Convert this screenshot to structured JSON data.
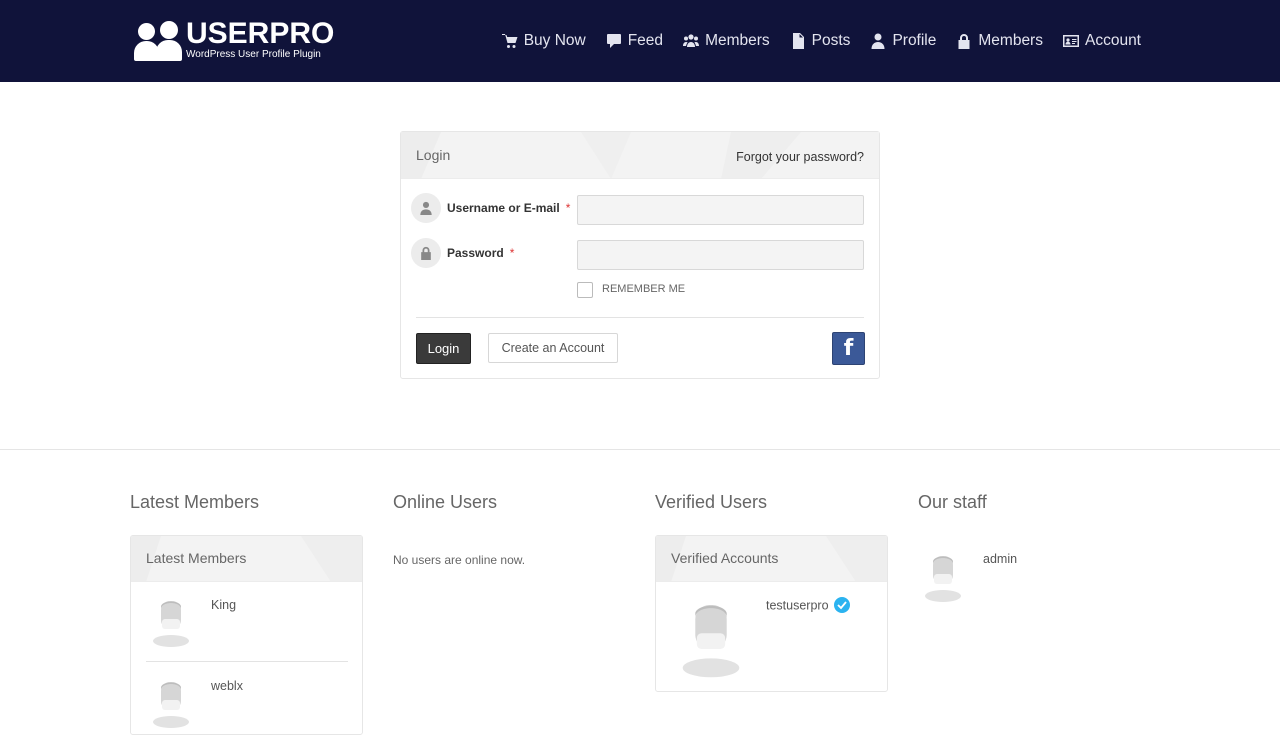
{
  "header": {
    "logo_title": "USERPRO",
    "logo_subtitle": "WordPress User Profile Plugin",
    "nav": [
      {
        "label": "Buy Now",
        "icon": "cart-icon"
      },
      {
        "label": "Feed",
        "icon": "comment-icon"
      },
      {
        "label": "Members",
        "icon": "users-icon"
      },
      {
        "label": "Posts",
        "icon": "document-icon"
      },
      {
        "label": "Profile",
        "icon": "user-icon"
      },
      {
        "label": "Members",
        "icon": "lock-icon"
      },
      {
        "label": "Account",
        "icon": "id-card-icon"
      }
    ]
  },
  "login": {
    "title": "Login",
    "forgot": "Forgot your password?",
    "username_label": "Username or E-mail",
    "password_label": "Password",
    "required_mark": "*",
    "username_value": "",
    "password_value": "",
    "remember_label": "REMEMBER ME",
    "login_button": "Login",
    "create_button": "Create an Account",
    "facebook_glyph": "f"
  },
  "widgets": {
    "latest": {
      "title": "Latest Members",
      "panel_title": "Latest Members",
      "members": [
        "King",
        "weblx"
      ]
    },
    "online": {
      "title": "Online Users",
      "empty_text": "No users are online now."
    },
    "verified": {
      "title": "Verified Users",
      "panel_title": "Verified Accounts",
      "members": [
        "testuserpro"
      ]
    },
    "staff": {
      "title": "Our staff",
      "members": [
        "admin"
      ]
    }
  },
  "colors": {
    "header_bg": "#10133a",
    "login_button_bg": "#3a3a3a",
    "facebook_bg": "#3b5998",
    "verified_badge": "#2bb3f0",
    "required": "#dd3333"
  }
}
